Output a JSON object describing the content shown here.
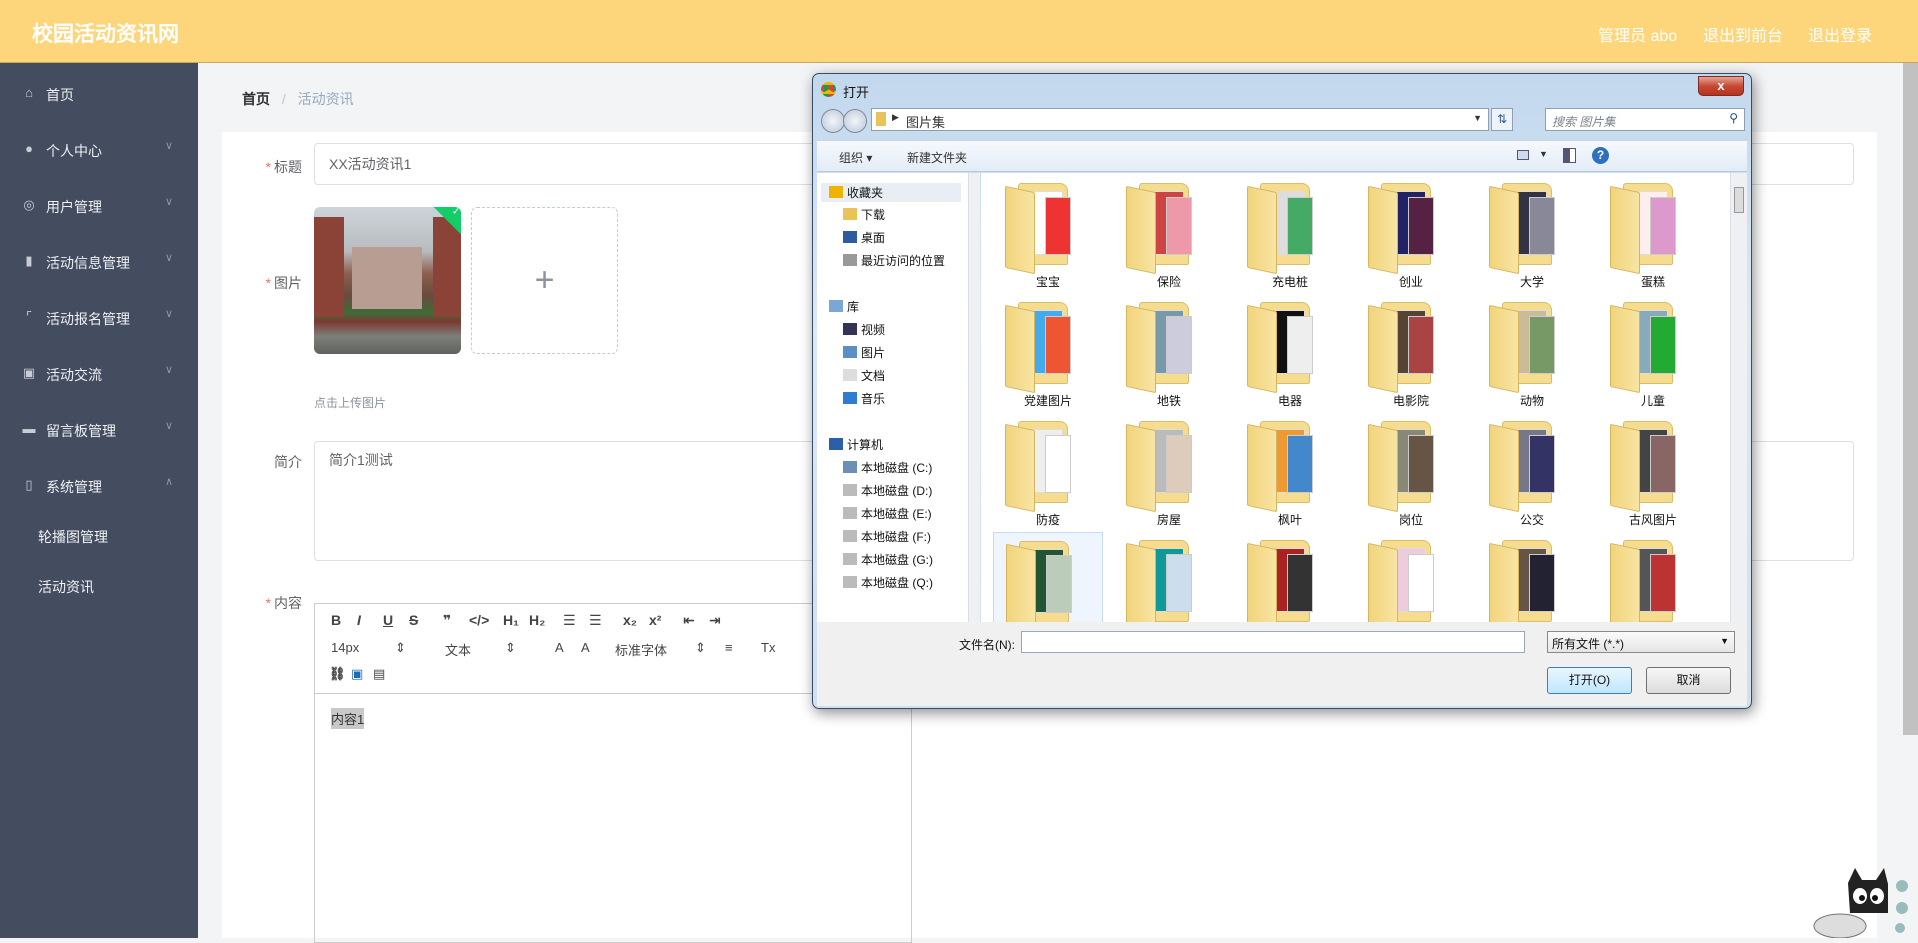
{
  "header": {
    "title": "校园活动资讯网",
    "user": "管理员 abo",
    "front": "退出到前台",
    "logout": "退出登录"
  },
  "sidebar": {
    "items": [
      {
        "label": "首页",
        "icon": "home-icon",
        "glyph": "⌂"
      },
      {
        "label": "个人中心",
        "icon": "user-icon",
        "glyph": "●",
        "chevron": "∨"
      },
      {
        "label": "用户管理",
        "icon": "crosshair-icon",
        "glyph": "◎",
        "chevron": "∨"
      },
      {
        "label": "活动信息管理",
        "icon": "bar-chart-icon",
        "glyph": "▮",
        "chevron": "∨"
      },
      {
        "label": "活动报名管理",
        "icon": "frame-icon",
        "glyph": "⌜",
        "chevron": "∨"
      },
      {
        "label": "活动交流",
        "icon": "clipboard-icon",
        "glyph": "▣",
        "chevron": "∨"
      },
      {
        "label": "留言板管理",
        "icon": "monitor-icon",
        "glyph": "▬",
        "chevron": "∨"
      },
      {
        "label": "系统管理",
        "icon": "microphone-icon",
        "glyph": "▯",
        "chevron": "∧"
      }
    ],
    "subitems": [
      "轮播图管理",
      "活动资讯"
    ]
  },
  "breadcrumb": {
    "home": "首页",
    "sep": "/",
    "current": "活动资讯"
  },
  "form": {
    "title_label": "标题",
    "title_value": "XX活动资讯1",
    "image_label": "图片",
    "upload_hint": "点击上传图片",
    "add_glyph": "+",
    "intro_label": "简介",
    "intro_value": "简介1测试",
    "content_label": "内容",
    "content_value": "内容1",
    "editor": {
      "row1": [
        "B",
        "I",
        "U",
        "S",
        "❞",
        "</>",
        "H₁",
        "H₂",
        "☰",
        "☰",
        "x₂",
        "x²",
        "⇤",
        "⇥"
      ],
      "font_size": "14px",
      "block": "文本",
      "font_family": "标准字体",
      "select_arrow": "⇕",
      "color": "A",
      "bg": "A",
      "align": "≡",
      "clear": "Tx"
    }
  },
  "dialog": {
    "title": "打开",
    "close": "x",
    "path": "图片集",
    "search_placeholder": "搜索 图片集",
    "organize": "组织 ▾",
    "new_folder": "新建文件夹",
    "nav": [
      {
        "label": "收藏夹",
        "icon": "star-icon",
        "level": 0
      },
      {
        "label": "下载",
        "icon": "download-folder-icon",
        "level": 1
      },
      {
        "label": "桌面",
        "icon": "desktop-icon",
        "level": 1
      },
      {
        "label": "最近访问的位置",
        "icon": "recent-places-icon",
        "level": 1
      },
      {
        "label": "库",
        "icon": "library-icon",
        "level": 0,
        "gap": true
      },
      {
        "label": "视频",
        "icon": "video-icon",
        "level": 1
      },
      {
        "label": "图片",
        "icon": "pictures-icon",
        "level": 1
      },
      {
        "label": "文档",
        "icon": "documents-icon",
        "level": 1
      },
      {
        "label": "音乐",
        "icon": "music-icon",
        "level": 1
      },
      {
        "label": "计算机",
        "icon": "computer-icon",
        "level": 0,
        "gap": true
      },
      {
        "label": "本地磁盘 (C:)",
        "icon": "system-drive-icon",
        "level": 1
      },
      {
        "label": "本地磁盘 (D:)",
        "icon": "drive-icon",
        "level": 1
      },
      {
        "label": "本地磁盘 (E:)",
        "icon": "drive-icon",
        "level": 1
      },
      {
        "label": "本地磁盘 (F:)",
        "icon": "drive-icon",
        "level": 1
      },
      {
        "label": "本地磁盘 (G:)",
        "icon": "drive-icon",
        "level": 1
      },
      {
        "label": "本地磁盘 (Q:)",
        "icon": "drive-icon",
        "level": 1
      }
    ],
    "folders": [
      "宝宝",
      "保险",
      "充电桩",
      "创业",
      "大学",
      "蛋糕",
      "党建图片",
      "地铁",
      "电器",
      "电影院",
      "动物",
      "儿童",
      "防疫",
      "房屋",
      "枫叶",
      "岗位",
      "公交",
      "古风图片",
      "",
      "",
      "",
      "",
      "",
      ""
    ],
    "filename_label": "文件名(N):",
    "filename_value": "",
    "filter": "所有文件 (*.*)",
    "open": "打开(O)",
    "cancel": "取消"
  },
  "colors": {
    "header": "#fdd67c",
    "sidebar": "#434d5f",
    "required": "#f56c6c"
  }
}
